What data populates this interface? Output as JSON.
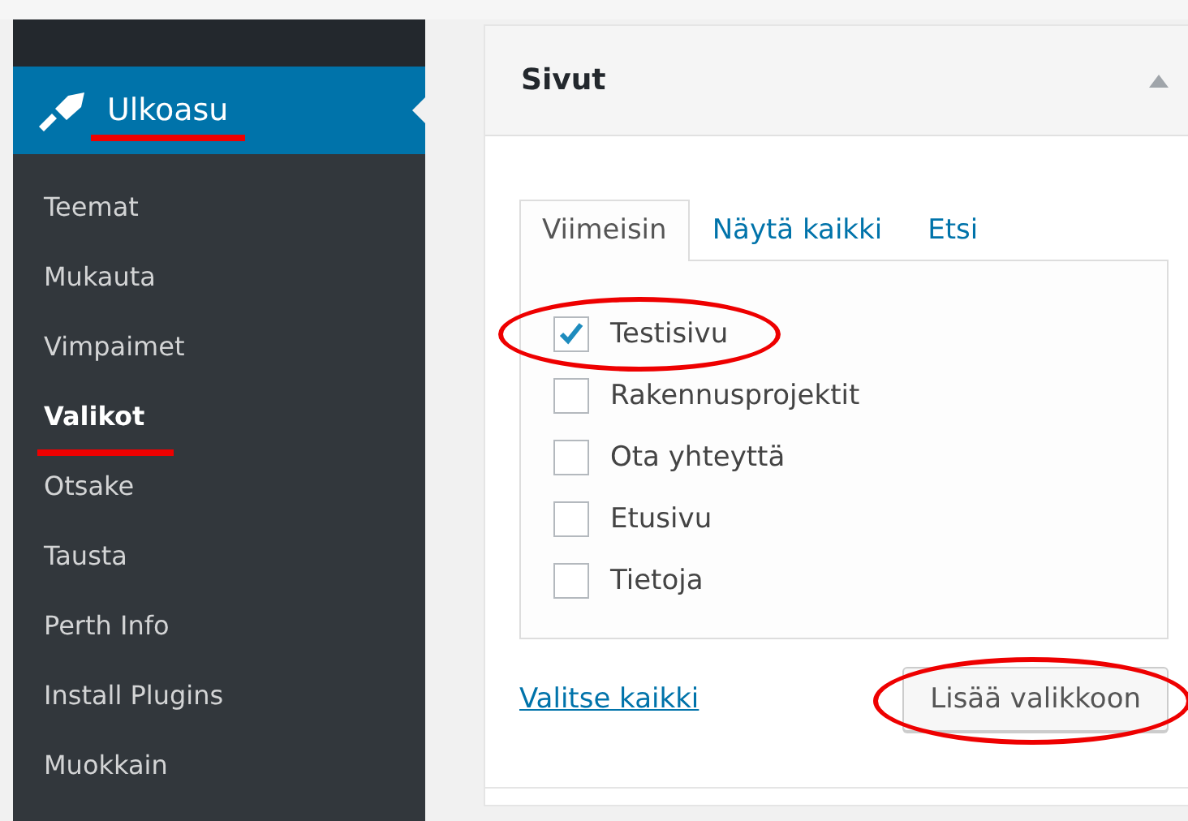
{
  "sidebar": {
    "header": {
      "label": "Ulkoasu",
      "marked": true
    },
    "items": [
      {
        "label": "Teemat",
        "current": false,
        "marked": false
      },
      {
        "label": "Mukauta",
        "current": false,
        "marked": false
      },
      {
        "label": "Vimpaimet",
        "current": false,
        "marked": false
      },
      {
        "label": "Valikot",
        "current": true,
        "marked": true
      },
      {
        "label": "Otsake",
        "current": false,
        "marked": false
      },
      {
        "label": "Tausta",
        "current": false,
        "marked": false
      },
      {
        "label": "Perth Info",
        "current": false,
        "marked": false
      },
      {
        "label": "Install Plugins",
        "current": false,
        "marked": false
      },
      {
        "label": "Muokkain",
        "current": false,
        "marked": false
      }
    ]
  },
  "panel": {
    "title": "Sivut",
    "expanded": true,
    "tabs": [
      {
        "label": "Viimeisin",
        "selected": true
      },
      {
        "label": "Näytä kaikki",
        "selected": false
      },
      {
        "label": "Etsi",
        "selected": false
      }
    ],
    "pages": [
      {
        "label": "Testisivu",
        "checked": true,
        "marked": true
      },
      {
        "label": "Rakennusprojektit",
        "checked": false,
        "marked": false
      },
      {
        "label": "Ota yhteyttä",
        "checked": false,
        "marked": false
      },
      {
        "label": "Etusivu",
        "checked": false,
        "marked": false
      },
      {
        "label": "Tietoja",
        "checked": false,
        "marked": false
      }
    ],
    "select_all": "Valitse kaikki",
    "button": {
      "label": "Lisää valikkoon",
      "marked": true
    }
  }
}
